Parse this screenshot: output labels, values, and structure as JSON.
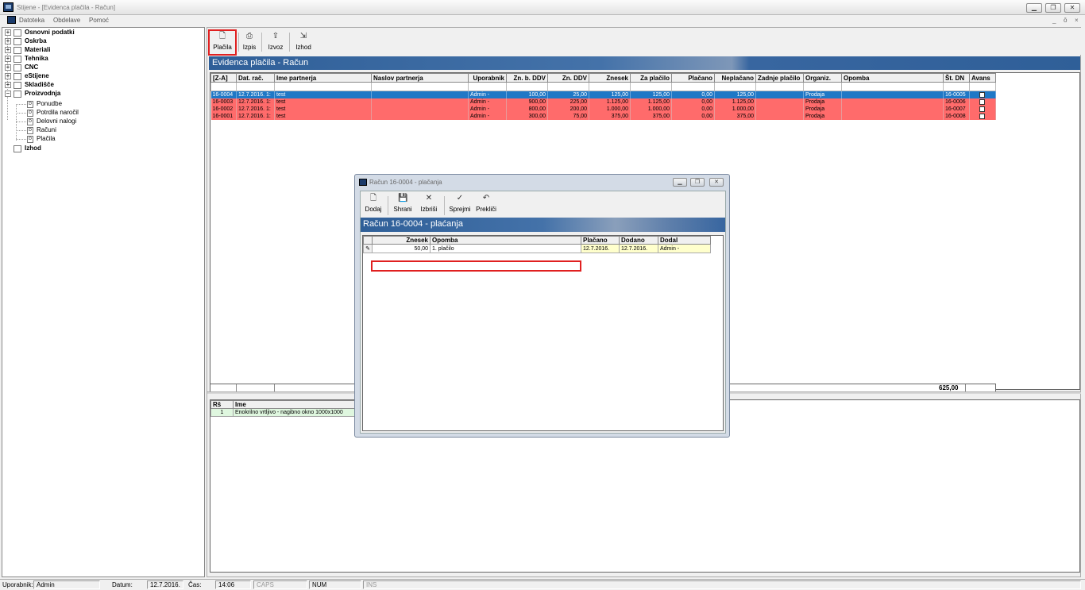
{
  "window": {
    "title": "Stijene - [Evidenca plačila - Račun]",
    "controls": {
      "minimize": "▁",
      "restore": "❐",
      "close": "✕"
    }
  },
  "menu": {
    "items": [
      "Datoteka",
      "Obdelave",
      "Pomoć"
    ],
    "mdi_controls": [
      "_",
      "ō",
      "×"
    ]
  },
  "tree": {
    "items": [
      {
        "label": "Osnovni podatki",
        "icon": "folder-icon"
      },
      {
        "label": "Oskrba",
        "icon": "folder-icon"
      },
      {
        "label": "Materiali",
        "icon": "folder-icon"
      },
      {
        "label": "Tehnika",
        "icon": "folder-icon"
      },
      {
        "label": "CNC",
        "icon": "folder-icon"
      },
      {
        "label": "eStijene",
        "icon": "folder-icon"
      },
      {
        "label": "Skladišče",
        "icon": "folder-icon"
      },
      {
        "label": "Proizvodnja",
        "icon": "folder-icon"
      }
    ],
    "children": [
      "Ponudbe",
      "Potrdila naročil",
      "Delovni nalogi",
      "Računi",
      "Plačila"
    ],
    "exit": "Izhod",
    "expand_plus": "+",
    "expand_minus": "−"
  },
  "toolbar": {
    "buttons": [
      {
        "label": "Plačila",
        "icon": "document-icon",
        "glyph": "🗋"
      },
      {
        "label": "Izpis",
        "icon": "printer-icon",
        "glyph": "⎙"
      },
      {
        "label": "Izvoz",
        "icon": "export-icon",
        "glyph": "⇪"
      },
      {
        "label": "Izhod",
        "icon": "exit-icon",
        "glyph": "⇲"
      }
    ]
  },
  "banner": {
    "title": "Evidenca plačila - Račun"
  },
  "grid": {
    "columns": [
      "[Z-A]",
      "Dat. rač.",
      "Ime partnerja",
      "Naslov partnerja",
      "Uporabnik",
      "Zn. b. DDV",
      "Zn. DDV",
      "Znesek",
      "Za plačilo",
      "Plačano",
      "Neplačano",
      "Zadnje plačilo",
      "Organiz.",
      "Opomba",
      "Št. DN",
      "Avans"
    ],
    "rows": [
      [
        "16-0004",
        "12.7.2016. 1:",
        "test",
        "",
        "Admin -",
        "100,00",
        "25,00",
        "125,00",
        "125,00",
        "0,00",
        "125,00",
        "",
        "Prodaja",
        "",
        "16-0005",
        ""
      ],
      [
        "16-0003",
        "12.7.2016. 1:",
        "test",
        "",
        "Admin -",
        "900,00",
        "225,00",
        "1.125,00",
        "1.125,00",
        "0,00",
        "1.125,00",
        "",
        "Prodaja",
        "",
        "16-0006",
        ""
      ],
      [
        "16-0002",
        "12.7.2016. 1:",
        "test",
        "",
        "Admin -",
        "800,00",
        "200,00",
        "1.000,00",
        "1.000,00",
        "0,00",
        "1.000,00",
        "",
        "Prodaja",
        "",
        "16-0007",
        ""
      ],
      [
        "16-0001",
        "12.7.2016. 1:",
        "test",
        "",
        "Admin -",
        "300,00",
        "75,00",
        "375,00",
        "375,00",
        "0,00",
        "375,00",
        "",
        "Prodaja",
        "",
        "16-0008",
        ""
      ]
    ],
    "footer_total": "625,00"
  },
  "detail": {
    "columns": [
      "Rš",
      "Ime"
    ],
    "rows": [
      [
        "1",
        "Enokrilno vrtljivo - nagibno okno 1000x1000"
      ]
    ]
  },
  "dialog": {
    "title": "Račun 16-0004 - plačanja",
    "banner": "Račun 16-0004 - plaćanja",
    "toolbar": [
      {
        "label": "Dodaj",
        "icon": "new-document-icon",
        "glyph": "🗋"
      },
      {
        "label": "Shrani",
        "icon": "save-icon",
        "glyph": "💾"
      },
      {
        "label": "Izbriši",
        "icon": "delete-icon",
        "glyph": "✕"
      },
      {
        "label": "Sprejmi",
        "icon": "check-icon",
        "glyph": "✓"
      },
      {
        "label": "Prekliči",
        "icon": "undo-icon",
        "glyph": "↶"
      }
    ],
    "columns": [
      "Znesek",
      "Opomba",
      "Plačano",
      "Dodano",
      "Dodal"
    ],
    "row": {
      "indicator": "✎",
      "znesek": "50,00",
      "opomba": "1. plačilo",
      "placano": "12.7.2016.",
      "dodano": "12.7.2016.",
      "dodal": "Admin -"
    }
  },
  "status": {
    "user_label": "Uporabnik:",
    "user": "Admin",
    "date_label": "Datum:",
    "date": "12.7.2016.",
    "time_label": "Čas:",
    "time": "14:06",
    "caps": "CAPS",
    "num": "NUM",
    "ins": "INS"
  },
  "colors": {
    "selected_row": "#1f78c6",
    "unpaid_row": "#ff6b6b",
    "banner": "#2f5f98",
    "highlight": "#e02020"
  }
}
